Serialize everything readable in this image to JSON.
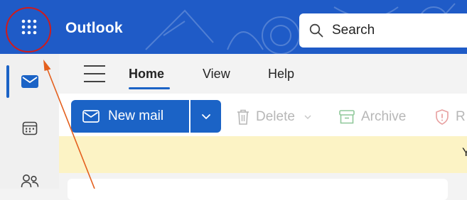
{
  "app": {
    "title": "Outlook"
  },
  "search": {
    "placeholder": "Search"
  },
  "rail": {
    "items": [
      {
        "icon": "mail-icon",
        "active": true
      },
      {
        "icon": "calendar-icon",
        "active": false
      },
      {
        "icon": "people-icon",
        "active": false
      }
    ]
  },
  "tabs": [
    {
      "label": "Home",
      "active": true
    },
    {
      "label": "View",
      "active": false
    },
    {
      "label": "Help",
      "active": false
    }
  ],
  "ribbon": {
    "new_mail": "New mail",
    "delete": "Delete",
    "archive": "Archive",
    "report_partial": "R"
  },
  "notice": {
    "text_partial": "Y"
  },
  "colors": {
    "header": "#1f5bc7",
    "accent": "#1b63c6",
    "notice_bg": "#fcf3c5",
    "annotation_ring": "#d01b1b",
    "annotation_arrow": "#e4601e"
  }
}
